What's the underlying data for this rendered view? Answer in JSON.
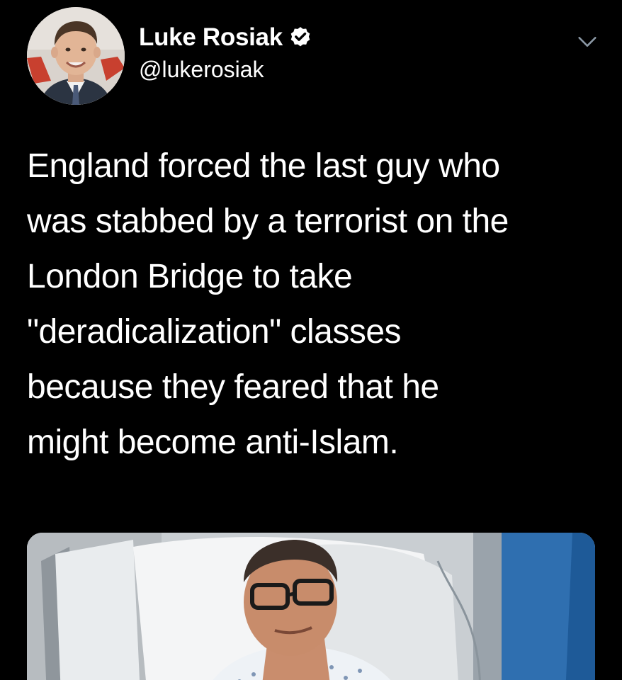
{
  "author": {
    "display_name": "Luke Rosiak",
    "handle": "@lukerosiak",
    "verified": true,
    "avatar_icon": "profile-photo",
    "verified_icon": "verified-badge-icon"
  },
  "menu": {
    "icon": "chevron-down-icon"
  },
  "tweet": {
    "lines": [
      "England forced the last guy who",
      "was stabbed by a terrorist on the",
      "London Bridge to take",
      "\"deradicalization\" classes",
      "because they feared that he",
      "might become anti-Islam."
    ]
  },
  "media": {
    "type": "photo",
    "description_icon": "attached-photo"
  },
  "colors": {
    "background": "#000000",
    "text": "#ffffff",
    "verified_badge": "#ffffff"
  }
}
